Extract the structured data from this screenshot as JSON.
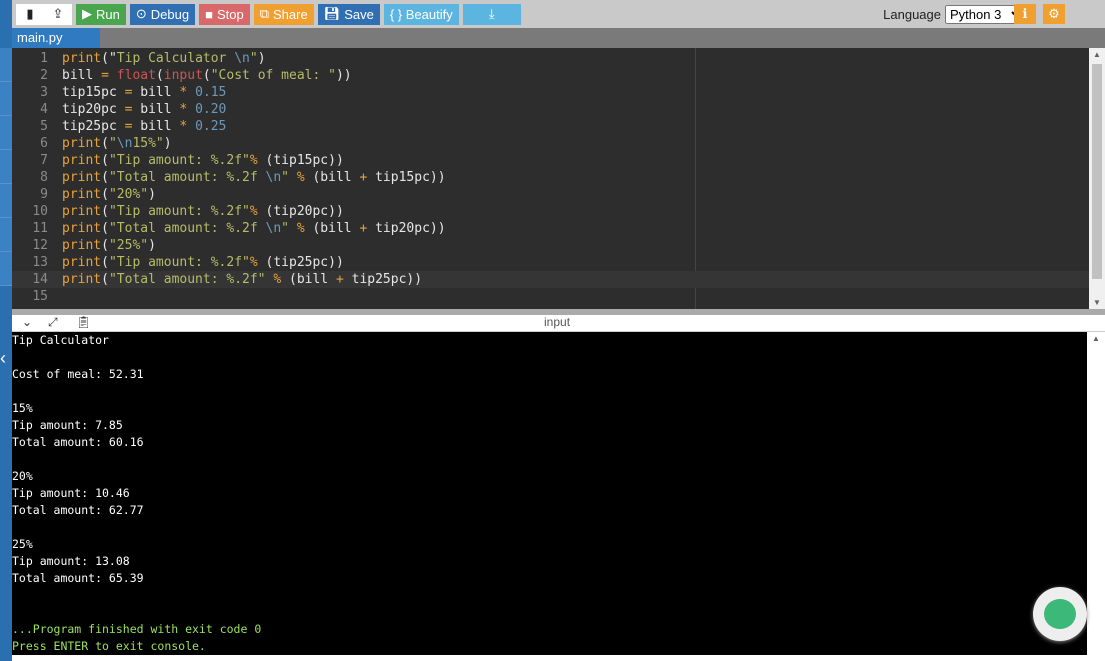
{
  "toolbar": {
    "new_file_icon": "file-icon",
    "upload_icon": "cloud-upload-icon",
    "run": "Run",
    "debug": "Debug",
    "stop": "Stop",
    "share": "Share",
    "save": "Save",
    "beautify": "{ } Beautify",
    "download_icon": "download-icon"
  },
  "language": {
    "label": "Language",
    "value": "Python 3"
  },
  "tab": "main.py",
  "colors": {
    "run": "#4aa64e",
    "debug": "#2f6fb2",
    "stop": "#d9686a",
    "share": "#f0a030",
    "save": "#2f6fb2",
    "beautify": "#5bb5e0",
    "download": "#5bb5e0"
  },
  "code": [
    [
      [
        "fn",
        "print"
      ],
      [
        "id",
        "(\""
      ],
      [
        "str",
        "Tip Calculator "
      ],
      [
        "esc",
        "\\n"
      ],
      [
        "str",
        "\""
      ],
      [
        "id",
        ")"
      ]
    ],
    [
      [
        "id",
        "bill "
      ],
      [
        "op",
        "="
      ],
      [
        "kw",
        " float"
      ],
      [
        "id",
        "("
      ],
      [
        "kw",
        "input"
      ],
      [
        "id",
        "("
      ],
      [
        "str",
        "\"Cost of meal: \""
      ],
      [
        "id",
        "))"
      ]
    ],
    [
      [
        "id",
        "tip15pc "
      ],
      [
        "op",
        "="
      ],
      [
        "id",
        " bill "
      ],
      [
        "op",
        "*"
      ],
      [
        "num",
        " 0.15"
      ]
    ],
    [
      [
        "id",
        "tip20pc "
      ],
      [
        "op",
        "="
      ],
      [
        "id",
        " bill "
      ],
      [
        "op",
        "*"
      ],
      [
        "num",
        " 0.20"
      ]
    ],
    [
      [
        "id",
        "tip25pc "
      ],
      [
        "op",
        "="
      ],
      [
        "id",
        " bill "
      ],
      [
        "op",
        "*"
      ],
      [
        "num",
        " 0.25"
      ]
    ],
    [
      [
        "fn",
        "print"
      ],
      [
        "id",
        "("
      ],
      [
        "str",
        "\""
      ],
      [
        "esc",
        "\\n"
      ],
      [
        "str",
        "15%\""
      ],
      [
        "id",
        ")"
      ]
    ],
    [
      [
        "fn",
        "print"
      ],
      [
        "id",
        "("
      ],
      [
        "str",
        "\"Tip amount: %.2f\""
      ],
      [
        "op",
        "%"
      ],
      [
        "id",
        " (tip15pc))"
      ]
    ],
    [
      [
        "fn",
        "print"
      ],
      [
        "id",
        "("
      ],
      [
        "str",
        "\"Total amount: %.2f "
      ],
      [
        "esc",
        "\\n"
      ],
      [
        "str",
        "\""
      ],
      [
        "op",
        " %"
      ],
      [
        "id",
        " (bill "
      ],
      [
        "op",
        "+"
      ],
      [
        "id",
        " tip15pc))"
      ]
    ],
    [
      [
        "fn",
        "print"
      ],
      [
        "id",
        "("
      ],
      [
        "str",
        "\"20%\""
      ],
      [
        "id",
        ")"
      ]
    ],
    [
      [
        "fn",
        "print"
      ],
      [
        "id",
        "("
      ],
      [
        "str",
        "\"Tip amount: %.2f\""
      ],
      [
        "op",
        "%"
      ],
      [
        "id",
        " (tip20pc))"
      ]
    ],
    [
      [
        "fn",
        "print"
      ],
      [
        "id",
        "("
      ],
      [
        "str",
        "\"Total amount: %.2f "
      ],
      [
        "esc",
        "\\n"
      ],
      [
        "str",
        "\""
      ],
      [
        "op",
        " %"
      ],
      [
        "id",
        " (bill "
      ],
      [
        "op",
        "+"
      ],
      [
        "id",
        " tip20pc))"
      ]
    ],
    [
      [
        "fn",
        "print"
      ],
      [
        "id",
        "("
      ],
      [
        "str",
        "\"25%\""
      ],
      [
        "id",
        ")"
      ]
    ],
    [
      [
        "fn",
        "print"
      ],
      [
        "id",
        "("
      ],
      [
        "str",
        "\"Tip amount: %.2f\""
      ],
      [
        "op",
        "%"
      ],
      [
        "id",
        " (tip25pc))"
      ]
    ],
    [
      [
        "fn",
        "print"
      ],
      [
        "id",
        "("
      ],
      [
        "str",
        "\"Total amount: %.2f\""
      ],
      [
        "op",
        " %"
      ],
      [
        "id",
        " (bill "
      ],
      [
        "op",
        "+"
      ],
      [
        "id",
        " tip25pc))"
      ]
    ],
    []
  ],
  "io_label": "input",
  "console": [
    "Tip Calculator",
    "",
    "Cost of meal: 52.31",
    "",
    "15%",
    "Tip amount: 7.85",
    "Total amount: 60.16",
    "",
    "20%",
    "Tip amount: 10.46",
    "Total amount: 62.77",
    "",
    "25%",
    "Tip amount: 13.08",
    "Total amount: 65.39",
    "",
    ""
  ],
  "console_end": [
    "...Program finished with exit code 0",
    "Press ENTER to exit console."
  ]
}
